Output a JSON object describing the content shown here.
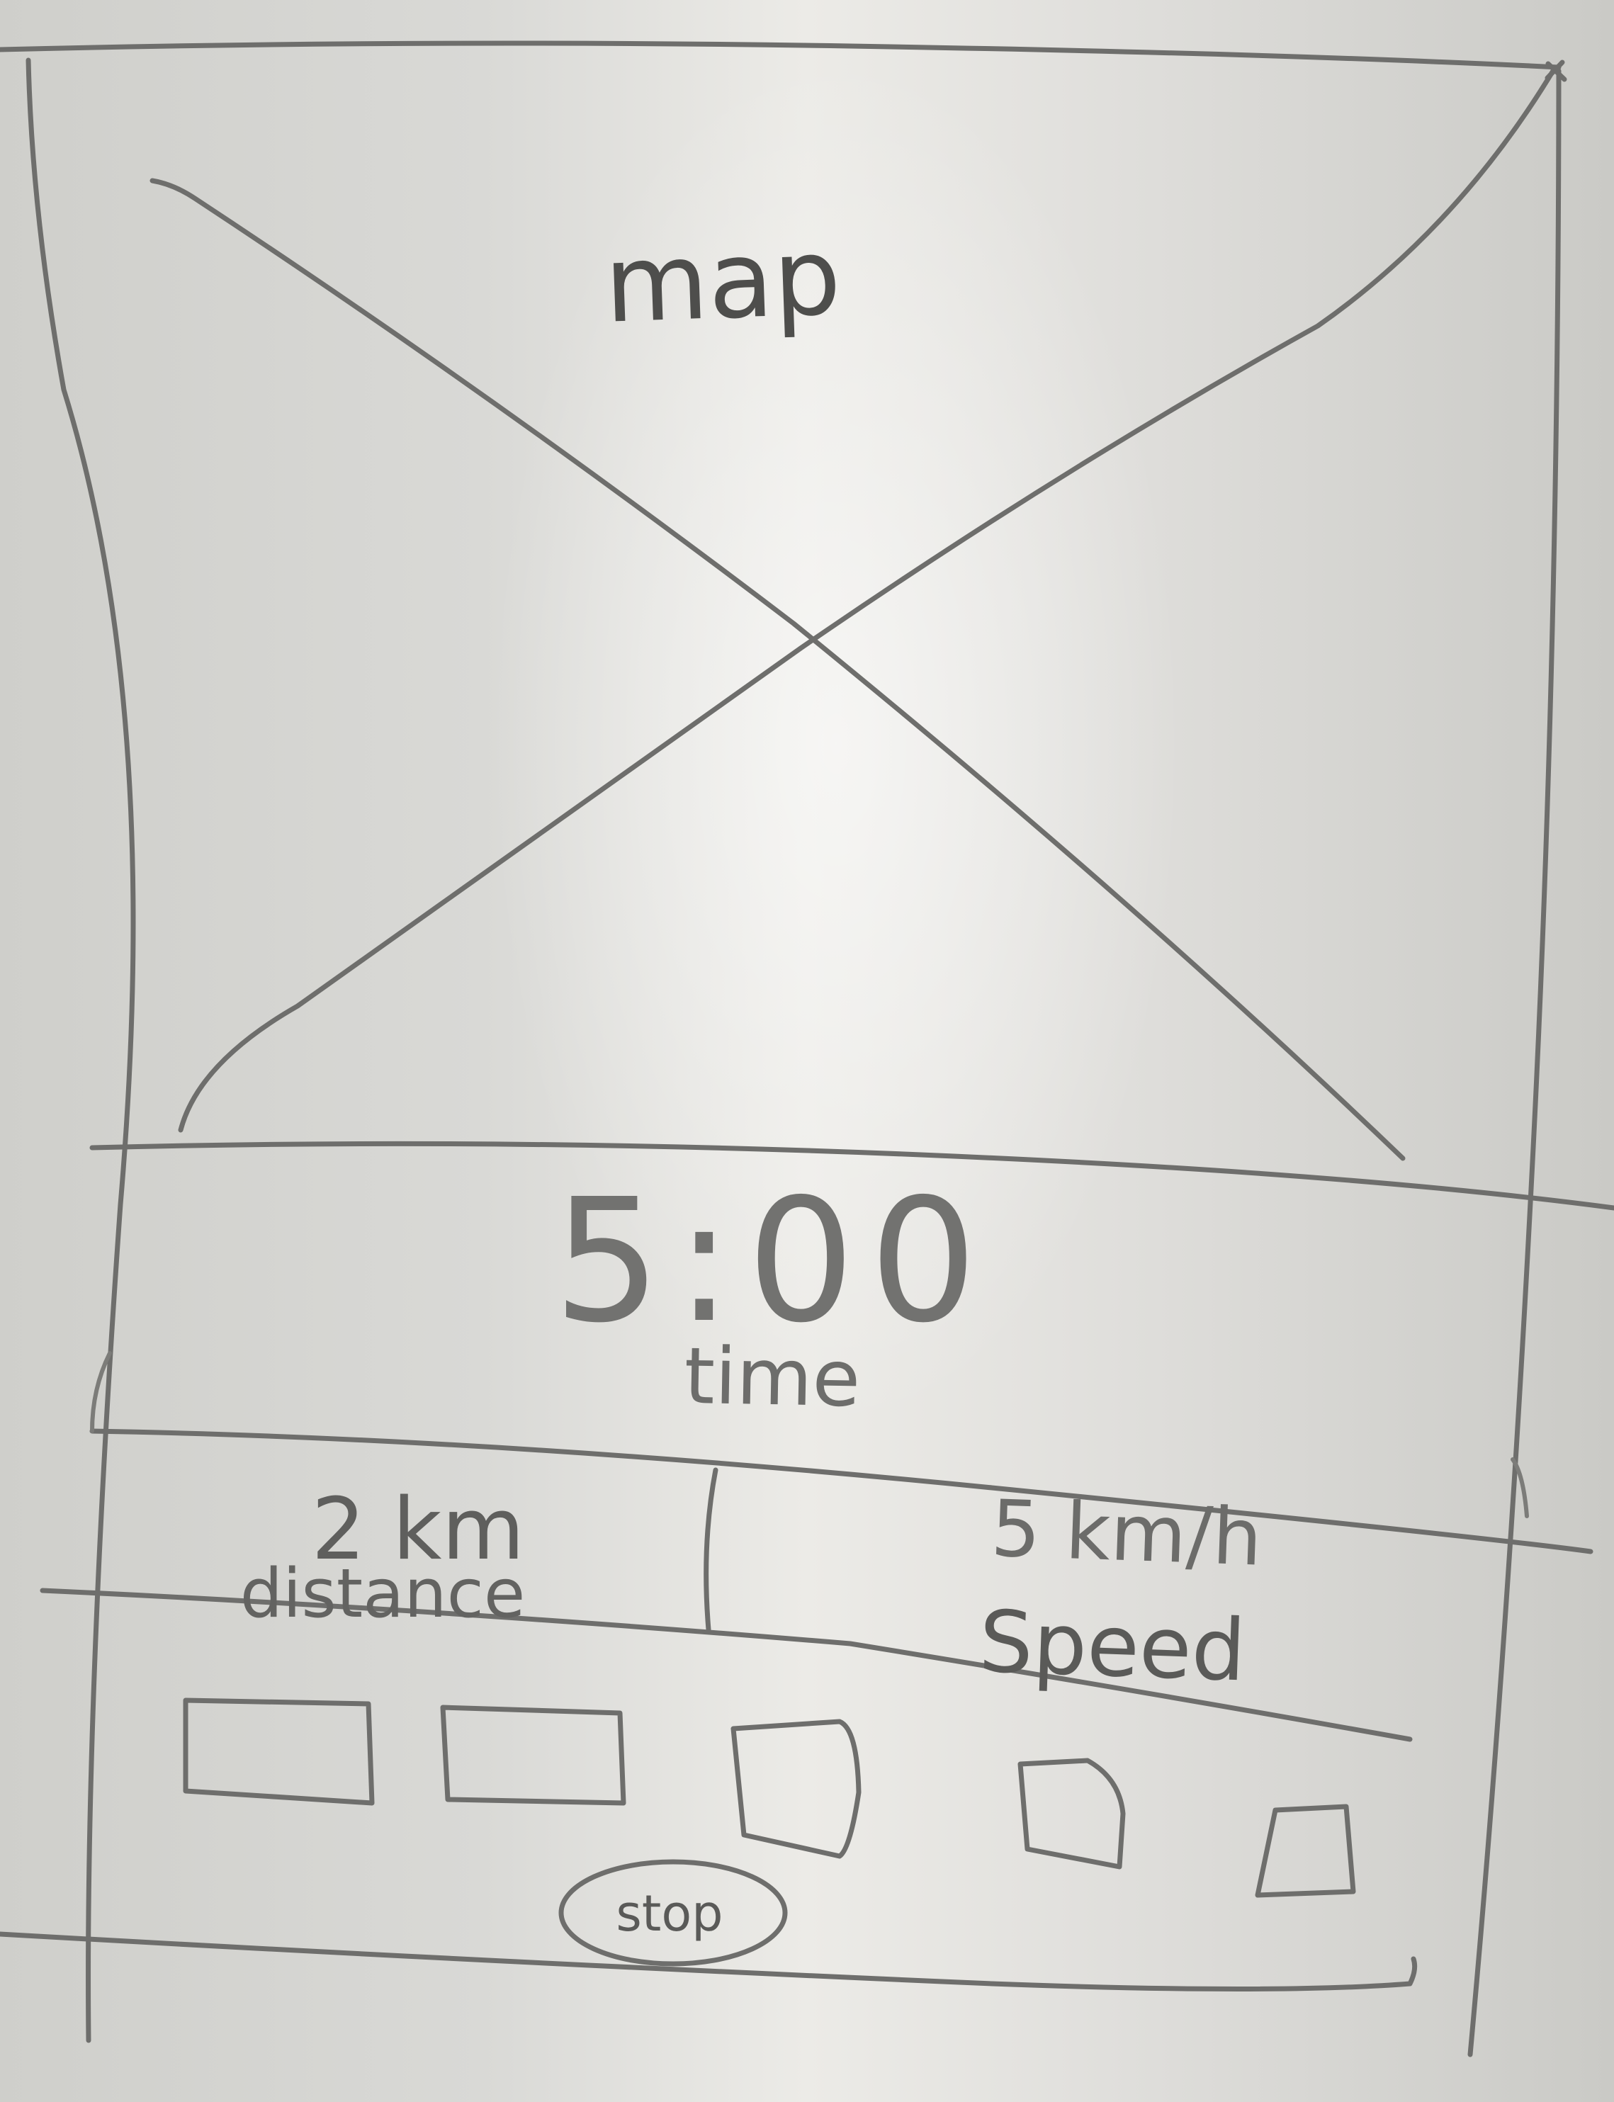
{
  "map": {
    "label": "map"
  },
  "timer": {
    "value": "5:00",
    "label": "time"
  },
  "stats": {
    "distance": {
      "value": "2 km",
      "label": "distance"
    },
    "speed": {
      "value": "5 km/h",
      "label": "Speed"
    }
  },
  "stop_button": {
    "label": "stop"
  }
}
